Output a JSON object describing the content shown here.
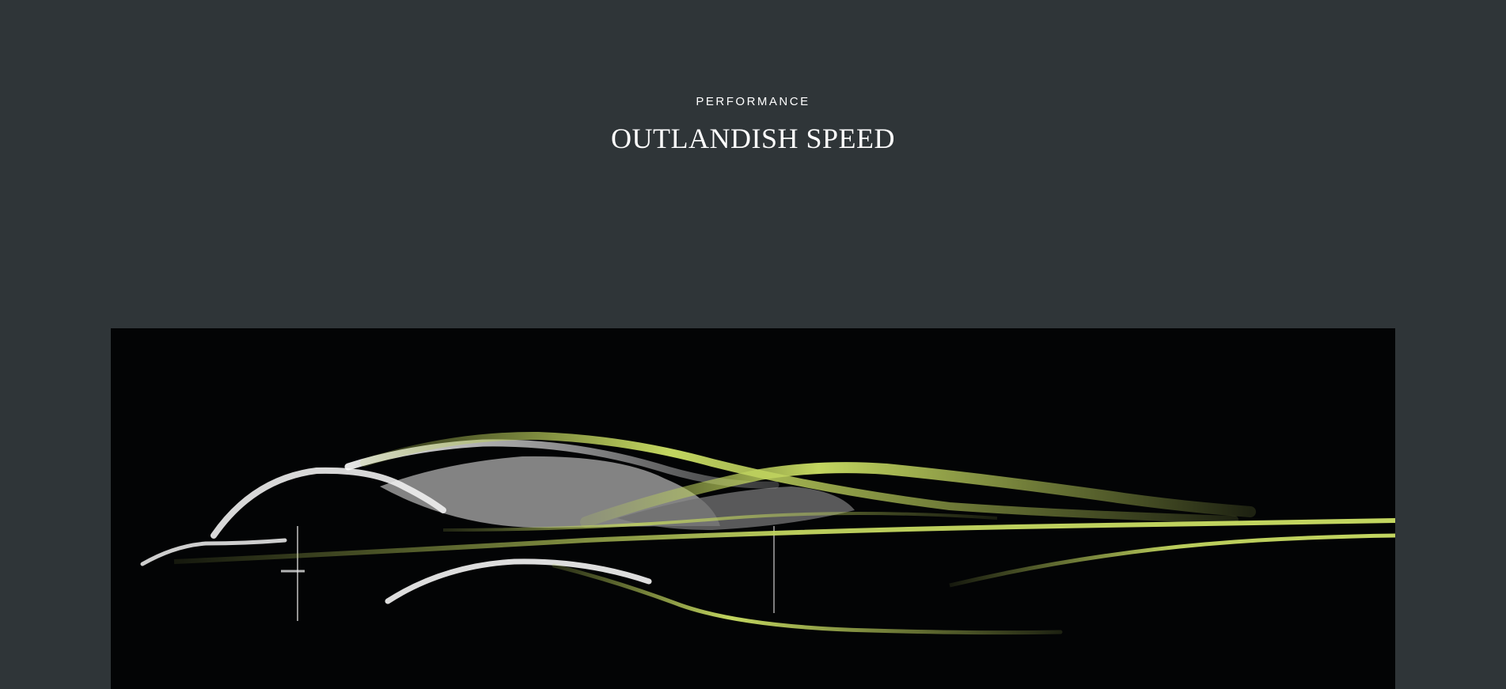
{
  "section": {
    "eyebrow": "PERFORMANCE",
    "title": "OUTLANDISH SPEED"
  },
  "hero_image": {
    "description_icon": "car-sketch-illustration"
  },
  "colors": {
    "page_background": "#2f3538",
    "hero_background": "#030405",
    "accent_green": "#b8cc5a",
    "sketch_white": "#e8e8e8",
    "sketch_grey": "#8a8a8a"
  }
}
